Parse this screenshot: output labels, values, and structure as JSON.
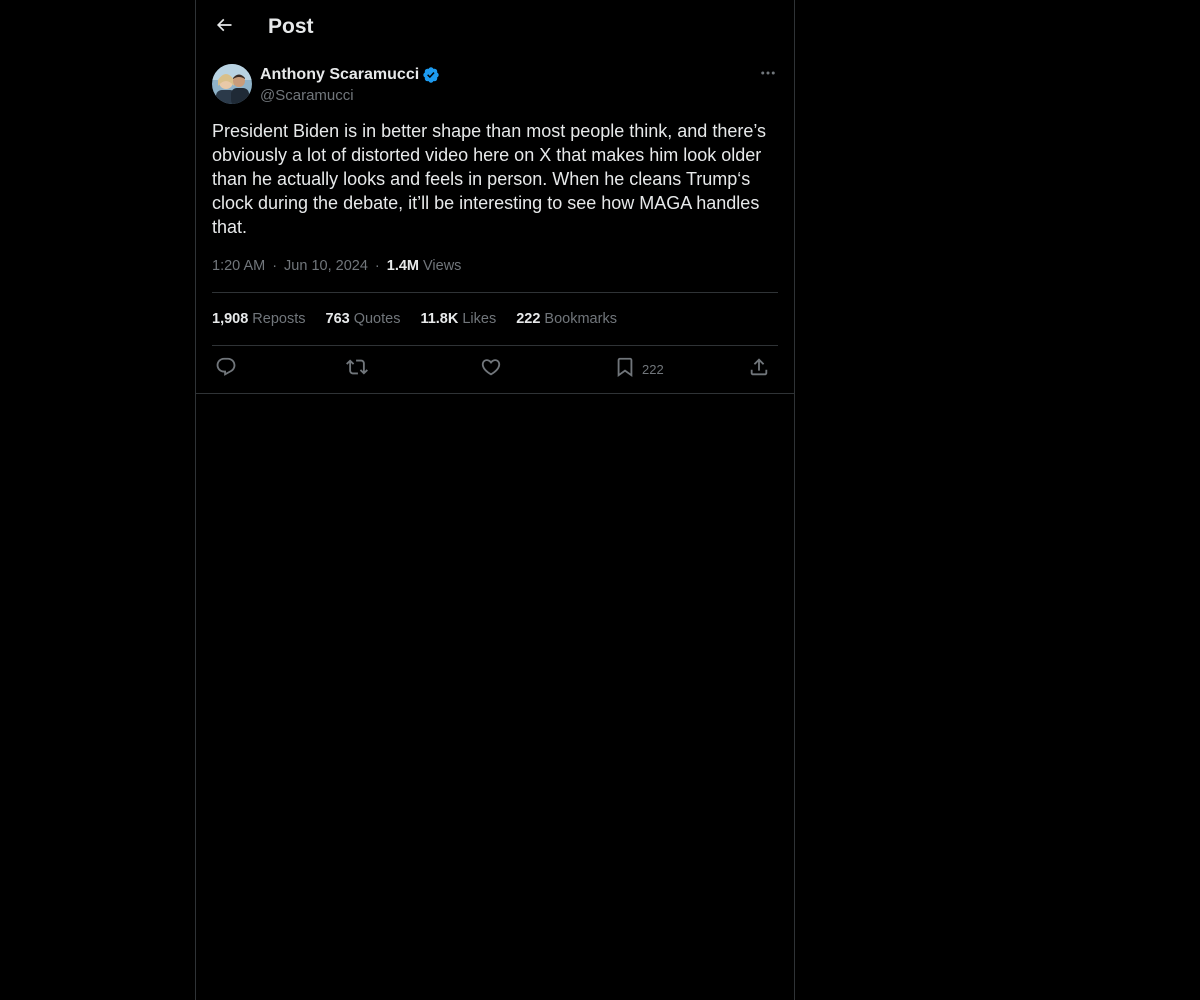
{
  "header": {
    "title": "Post",
    "back_icon": "arrow-left-icon"
  },
  "author": {
    "name": "Anthony Scaramucci",
    "handle": "@Scaramucci",
    "verified": true,
    "verified_color": "#1d9bf0"
  },
  "post": {
    "text": "President Biden is in better shape than most people think, and there’s obviously a lot of distorted video here on X that makes him look older than he actually looks and feels in person. When he cleans Trump‘s clock during the debate, it’ll be interesting to see how MAGA handles that.",
    "time": "1:20 AM",
    "date": "Jun 10, 2024",
    "views_count": "1.4M",
    "views_label": "Views",
    "separator": "·"
  },
  "stats": {
    "reposts": {
      "count": "1,908",
      "label": "Reposts"
    },
    "quotes": {
      "count": "763",
      "label": "Quotes"
    },
    "likes": {
      "count": "11.8K",
      "label": "Likes"
    },
    "bookmarks": {
      "count": "222",
      "label": "Bookmarks"
    }
  },
  "actions": {
    "reply_icon": "reply-icon",
    "repost_icon": "repost-icon",
    "like_icon": "heart-icon",
    "bookmark_icon": "bookmark-icon",
    "bookmark_count": "222",
    "share_icon": "share-icon"
  },
  "colors": {
    "background": "#000000",
    "border": "#2f3336",
    "primary_text": "#e7e9ea",
    "secondary_text": "#71767b"
  }
}
